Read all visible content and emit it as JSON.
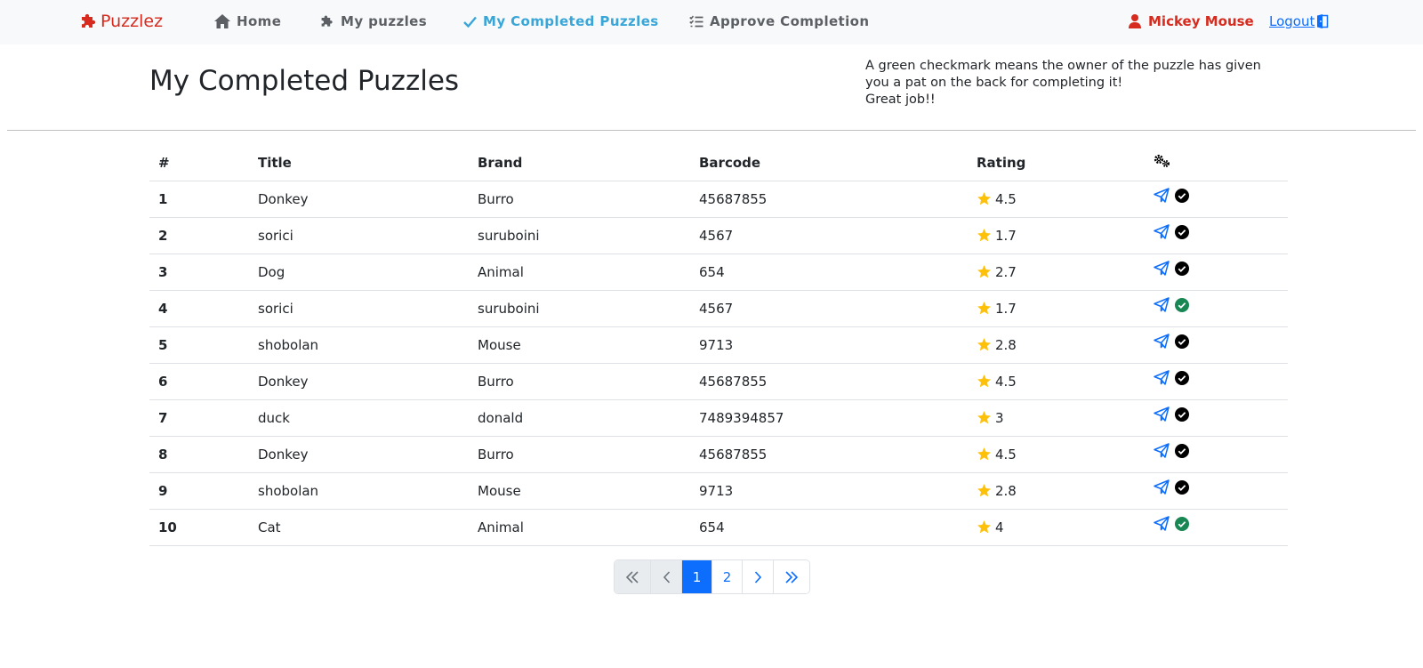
{
  "nav": {
    "brand": "Puzzlez",
    "links": [
      {
        "label": "Home",
        "icon": "home-icon"
      },
      {
        "label": "My puzzles",
        "icon": "puzzle-piece-icon"
      },
      {
        "label": "My Completed Puzzles",
        "icon": "check-icon",
        "active": true
      },
      {
        "label": "Approve Completion",
        "icon": "list-check-icon"
      }
    ],
    "user_name": "Mickey Mouse",
    "logout_label": "Logout"
  },
  "page": {
    "title": "My Completed Puzzles",
    "info_lines": [
      "A green checkmark means the owner of the puzzle has given",
      "you a pat on the back for completing it!",
      "Great job!!"
    ]
  },
  "table": {
    "headers": {
      "num": "#",
      "title": "Title",
      "brand": "Brand",
      "barcode": "Barcode",
      "rating": "Rating",
      "actions_icon": "gears-icon"
    },
    "rows": [
      {
        "num": "1",
        "title": "Donkey",
        "brand": "Burro",
        "barcode": "45687855",
        "rating": "4.5",
        "approved": false
      },
      {
        "num": "2",
        "title": "sorici",
        "brand": "suruboini",
        "barcode": "4567",
        "rating": "1.7",
        "approved": false
      },
      {
        "num": "3",
        "title": "Dog",
        "brand": "Animal",
        "barcode": "654",
        "rating": "2.7",
        "approved": false
      },
      {
        "num": "4",
        "title": "sorici",
        "brand": "suruboini",
        "barcode": "4567",
        "rating": "1.7",
        "approved": true
      },
      {
        "num": "5",
        "title": "shobolan",
        "brand": "Mouse",
        "barcode": "9713",
        "rating": "2.8",
        "approved": false
      },
      {
        "num": "6",
        "title": "Donkey",
        "brand": "Burro",
        "barcode": "45687855",
        "rating": "4.5",
        "approved": false
      },
      {
        "num": "7",
        "title": "duck",
        "brand": "donald",
        "barcode": "7489394857",
        "rating": "3",
        "approved": false
      },
      {
        "num": "8",
        "title": "Donkey",
        "brand": "Burro",
        "barcode": "45687855",
        "rating": "4.5",
        "approved": false
      },
      {
        "num": "9",
        "title": "shobolan",
        "brand": "Mouse",
        "barcode": "9713",
        "rating": "2.8",
        "approved": false
      },
      {
        "num": "10",
        "title": "Cat",
        "brand": "Animal",
        "barcode": "654",
        "rating": "4",
        "approved": true
      }
    ]
  },
  "pagination": {
    "current_page": "1",
    "pages": [
      "1",
      "2"
    ],
    "first_icon": "double-chevron-left-icon",
    "prev_icon": "chevron-left-icon",
    "next_icon": "chevron-right-icon",
    "last_icon": "double-chevron-right-icon"
  },
  "colors": {
    "brand": "#d62b1e",
    "active_nav": "#3aa6d8",
    "nav_text": "#5c5f63",
    "navbar_bg": "#f8f9fa",
    "link_blue": "#0d6efd",
    "star": "#ffc107",
    "approved_check": "#198754",
    "unapproved_check": "#000000"
  }
}
